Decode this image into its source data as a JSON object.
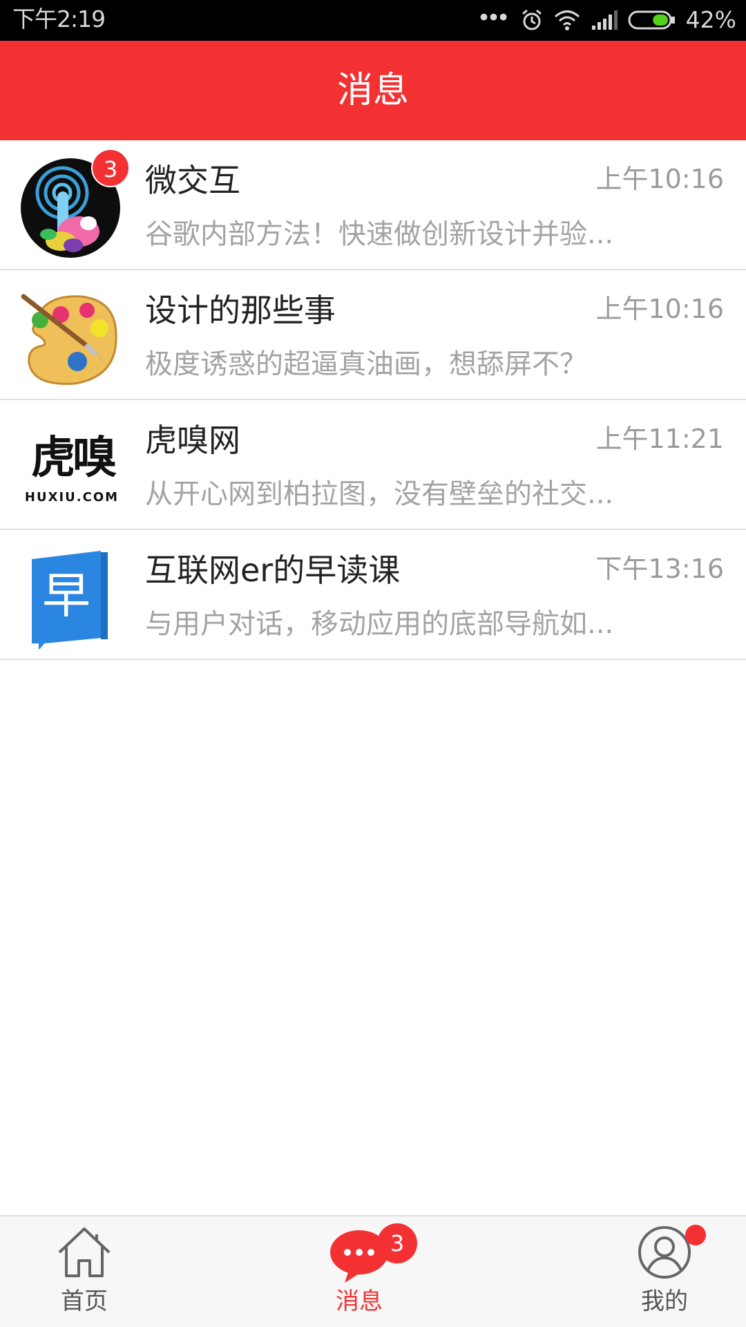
{
  "status_bar": {
    "time": "下午2:19",
    "battery_percent": "42%",
    "battery_level": 0.42,
    "icons": [
      "more-dots-icon",
      "alarm-icon",
      "wifi-icon",
      "signal-icon",
      "battery-icon"
    ]
  },
  "header": {
    "title": "消息"
  },
  "messages": [
    {
      "name": "微交互",
      "time": "上午10:16",
      "preview": "谷歌内部方法！快速做创新设计并验...",
      "unread": "3",
      "avatar": "touch-logo"
    },
    {
      "name": "设计的那些事",
      "time": "上午10:16",
      "preview": "极度诱惑的超逼真油画，想舔屏不？",
      "avatar": "palette-logo"
    },
    {
      "name": "虎嗅网",
      "time": "上午11:21",
      "preview": "从开心网到柏拉图，没有壁垒的社交...",
      "avatar": "huxiu-logo",
      "avatar_text": "虎嗅",
      "avatar_subtext": "HUXIU.COM"
    },
    {
      "name": "互联网er的早读课",
      "time": "下午13:16",
      "preview": "与用户对话，移动应用的底部导航如...",
      "avatar": "zao-book-logo",
      "avatar_text": "早"
    }
  ],
  "tabbar": {
    "home_label": "首页",
    "messages_label": "消息",
    "messages_badge": "3",
    "me_label": "我的"
  },
  "colors": {
    "accent": "#f33133",
    "text": "#222222",
    "muted": "#a3a3a3",
    "tabbar_bg": "#f7f7f7"
  }
}
